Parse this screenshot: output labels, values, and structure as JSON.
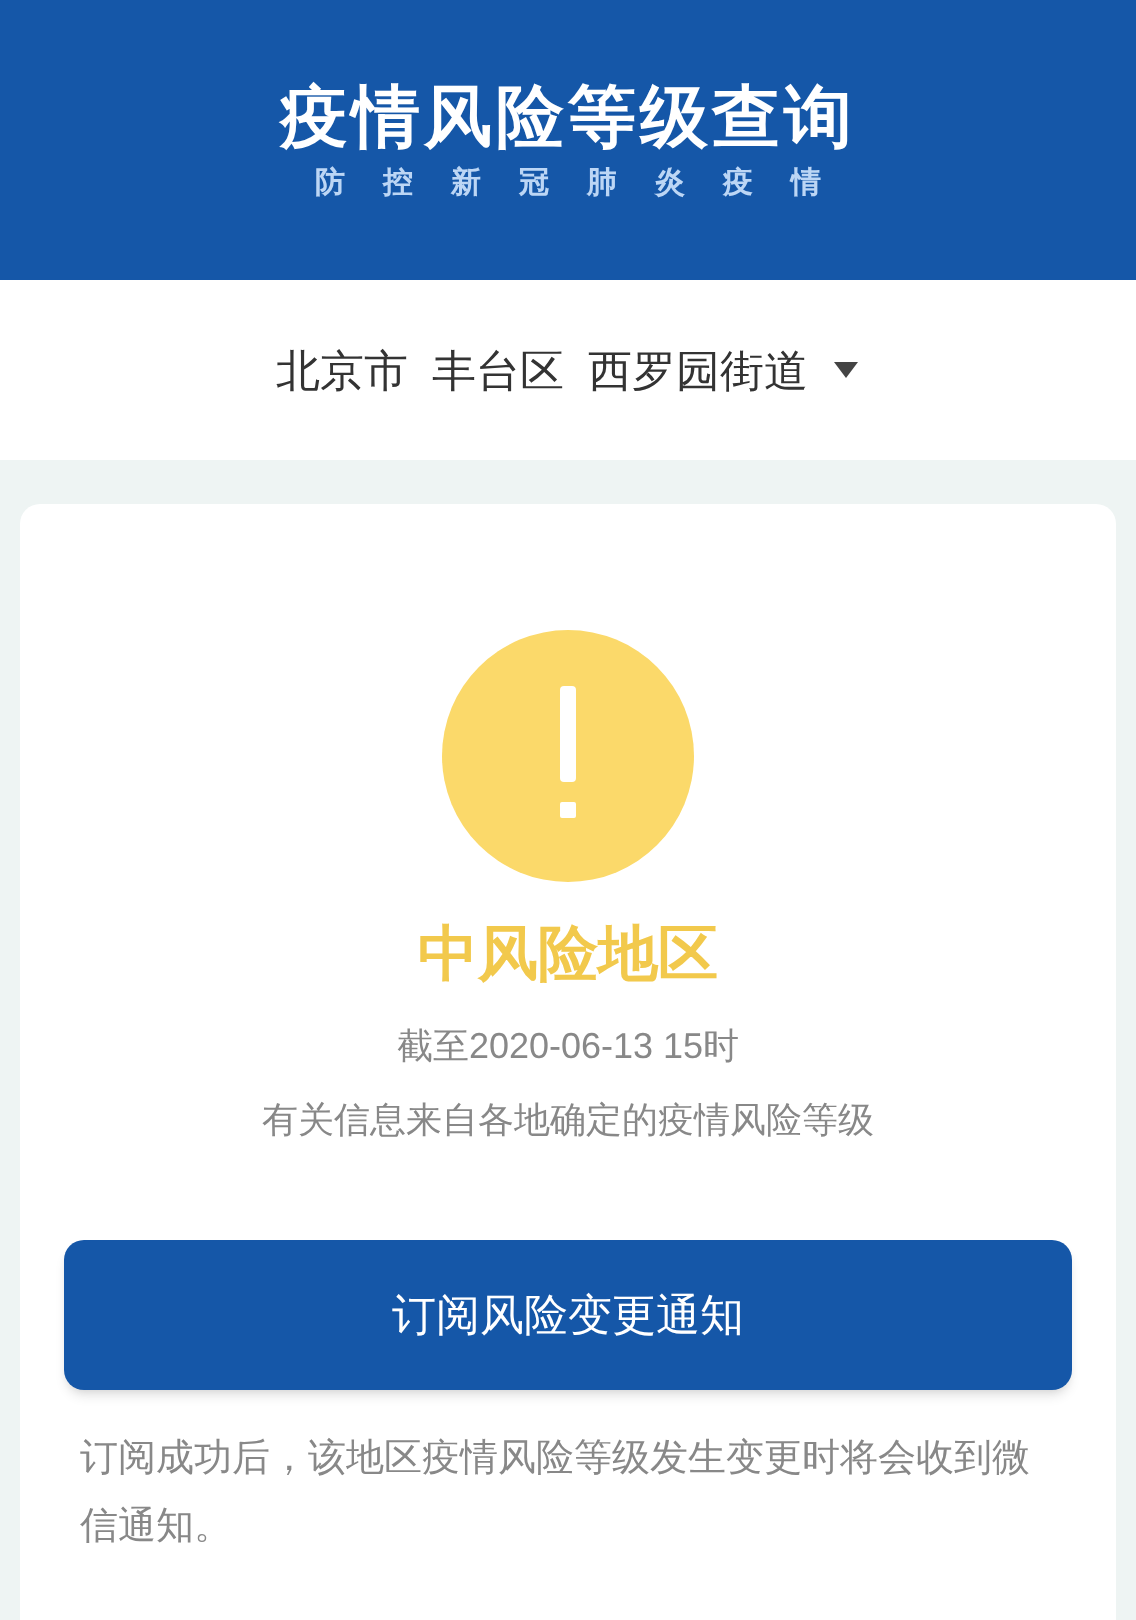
{
  "header": {
    "title": "疫情风险等级查询",
    "subtitle": "防控新冠肺炎疫情"
  },
  "location": {
    "parts": [
      "北京市",
      "丰台区",
      "西罗园街道"
    ]
  },
  "risk": {
    "kind": "medium",
    "label": "中风险地区",
    "updated": "截至2020-06-13 15时",
    "source": "有关信息来自各地确定的疫情风险等级"
  },
  "subscribe_button": "订阅风险变更通知",
  "note": "订阅成功后，该地区疫情风险等级发生变更时将会收到微信通知。"
}
